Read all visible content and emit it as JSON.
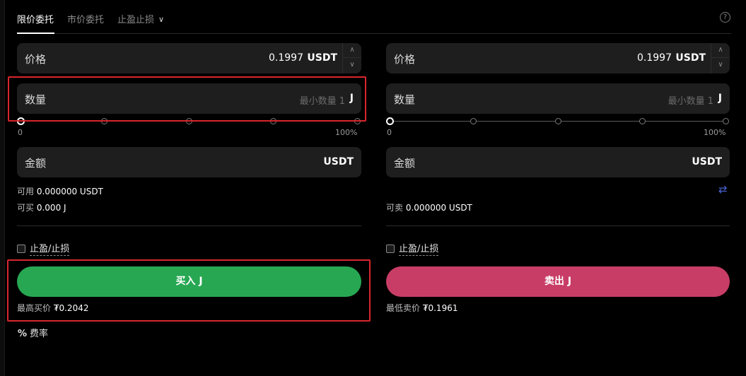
{
  "tabs": [
    {
      "label": "限价委托",
      "active": true
    },
    {
      "label": "市价委托",
      "active": false
    },
    {
      "label": "止盈止损",
      "active": false
    }
  ],
  "buy": {
    "price_label": "价格",
    "price_value": "0.1997",
    "price_unit": "USDT",
    "qty_label": "数量",
    "qty_placeholder": "最小数量 1",
    "qty_unit": "J",
    "slider_min": "0",
    "slider_max": "100%",
    "slider_value_percent": 0,
    "amount_label": "金额",
    "amount_unit": "USDT",
    "available_label": "可用",
    "available_value": "0.000000 USDT",
    "can_buy_label": "可买",
    "can_buy_value": "0.000 J",
    "tpsl_label": "止盈/止损",
    "button_label": "买入 J",
    "best_price_label": "最高买价",
    "best_price_value": "₮0.2042"
  },
  "sell": {
    "price_label": "价格",
    "price_value": "0.1997",
    "price_unit": "USDT",
    "qty_label": "数量",
    "qty_placeholder": "最小数量 1",
    "qty_unit": "J",
    "slider_min": "0",
    "slider_max": "100%",
    "slider_value_percent": 0,
    "amount_label": "金额",
    "amount_unit": "USDT",
    "can_sell_label": "可卖",
    "can_sell_value": "0.000000 USDT",
    "tpsl_label": "止盈/止损",
    "button_label": "卖出 J",
    "best_price_label": "最低卖价",
    "best_price_value": "₮0.1961"
  },
  "fee_label": "费率",
  "colors": {
    "buy": "#27a752",
    "sell": "#c83d66",
    "highlight": "#d8262d",
    "swap_icon": "#4a63d8"
  }
}
